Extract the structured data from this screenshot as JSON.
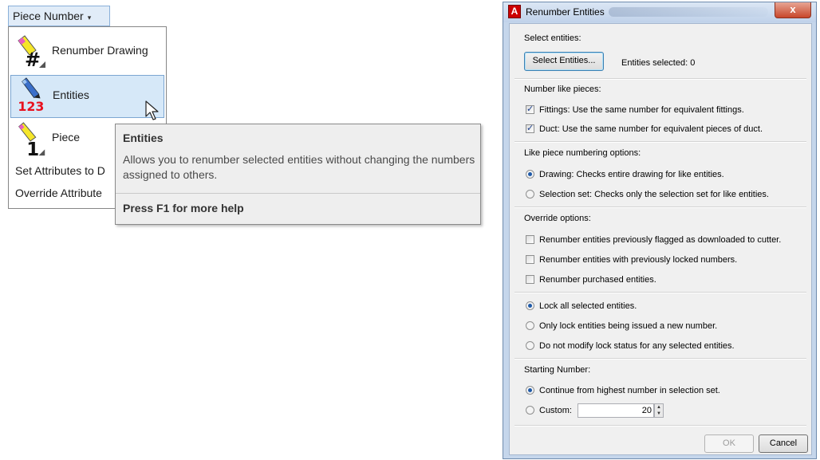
{
  "ribbon": {
    "button_label": "Piece Number",
    "dropdown_arrow": "▾"
  },
  "menu": {
    "items": [
      {
        "label": "Renumber Drawing",
        "icon": "renumber-drawing-icon"
      },
      {
        "label": "Entities",
        "icon": "renumber-entities-icon",
        "icon_text": "123"
      },
      {
        "label": "Piece",
        "icon": "renumber-piece-icon",
        "icon_text": "1"
      },
      {
        "label": "Set Attributes to D"
      },
      {
        "label": "Override Attribute"
      }
    ]
  },
  "tooltip": {
    "title": "Entities",
    "description": "Allows you to renumber selected entities without changing the numbers assigned to others.",
    "help": "Press F1 for more help"
  },
  "dialog": {
    "app_icon": "A",
    "title": "Renumber Entities",
    "close": "x",
    "select_section": {
      "label": "Select entities:",
      "button": "Select Entities...",
      "status": "Entities selected: 0"
    },
    "number_like": {
      "label": "Number like pieces:",
      "options": [
        {
          "label": "Fittings: Use the same number for equivalent fittings.",
          "checked": true
        },
        {
          "label": "Duct: Use the same number for equivalent pieces of duct.",
          "checked": true
        }
      ]
    },
    "like_piece": {
      "label": "Like piece numbering options:",
      "options": [
        {
          "label": "Drawing: Checks entire drawing for like entities.",
          "selected": true
        },
        {
          "label": "Selection set: Checks only the selection set for like entities.",
          "selected": false
        }
      ]
    },
    "override": {
      "label": "Override options:",
      "checkboxes": [
        {
          "label": "Renumber entities previously flagged as downloaded to cutter.",
          "checked": false
        },
        {
          "label": "Renumber entities with previously locked numbers.",
          "checked": false
        },
        {
          "label": "Renumber purchased entities.",
          "checked": false
        }
      ],
      "lock_options": [
        {
          "label": "Lock all selected entities.",
          "selected": true
        },
        {
          "label": "Only lock entities being issued a new number.",
          "selected": false
        },
        {
          "label": "Do not modify lock status for any selected entities.",
          "selected": false
        }
      ]
    },
    "starting": {
      "label": "Starting Number:",
      "options": [
        {
          "label": "Continue from highest number in selection set.",
          "selected": true
        },
        {
          "label": "Custom:",
          "selected": false
        }
      ],
      "custom_value": "20"
    },
    "buttons": {
      "ok": "OK",
      "cancel": "Cancel"
    }
  },
  "colors": {
    "menu_highlight": "#d6e8f8",
    "tooltip_bg": "#eeeeee",
    "dialog_frame": "#c5d6eb",
    "icon_red": "#e8101e"
  }
}
